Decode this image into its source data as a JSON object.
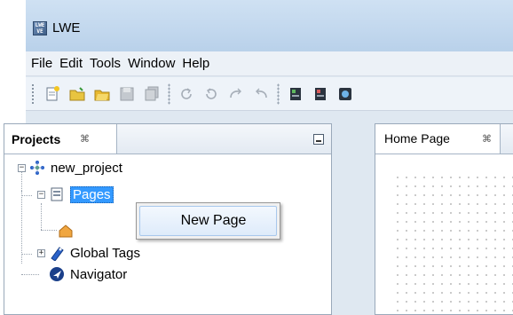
{
  "app": {
    "title": "LWE",
    "icon_text": "LWE VE"
  },
  "menu": [
    "File",
    "Edit",
    "Tools",
    "Window",
    "Help"
  ],
  "toolbar": {
    "buttons": [
      "new-file-icon",
      "open-folder-icon",
      "open-project-icon",
      "save-icon",
      "save-all-icon",
      "refresh-icon",
      "reload-icon",
      "redo-icon",
      "undo-icon",
      "run-icon",
      "stop-icon",
      "device-icon"
    ]
  },
  "projects_panel": {
    "title": "Projects",
    "close_glyph": "⌘",
    "tree": {
      "root": "new_project",
      "pages": "Pages",
      "global_tags": "Global Tags",
      "navigator": "Navigator"
    }
  },
  "context_menu": {
    "item": "New Page"
  },
  "editor": {
    "tab_label": "Home Page",
    "close_glyph": "⌘"
  },
  "colors": {
    "selection": "#3399ff",
    "titlebar": "#b9d1ea",
    "menu_highlight": "#deebfa"
  }
}
